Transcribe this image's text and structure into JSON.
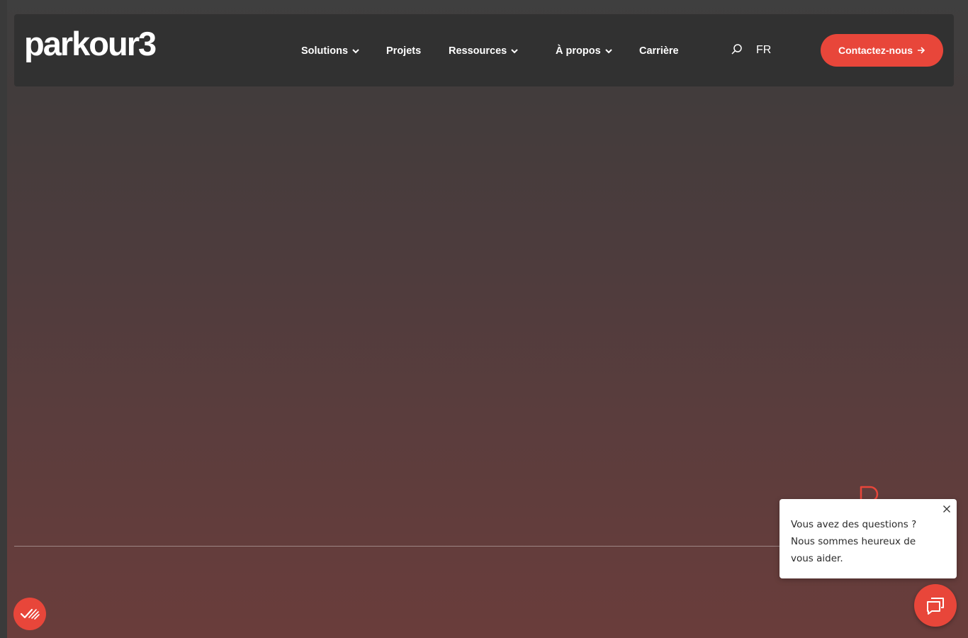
{
  "header": {
    "logo": "parkour3",
    "nav": [
      {
        "label": "Solutions",
        "has_dropdown": true
      },
      {
        "label": "Projets",
        "has_dropdown": false
      },
      {
        "label": "Ressources",
        "has_dropdown": true
      },
      {
        "label": "À propos",
        "has_dropdown": true
      },
      {
        "label": "Carrière",
        "has_dropdown": false
      }
    ],
    "search_icon": "search-icon",
    "language": "FR",
    "cta_label": "Contactez-nous",
    "cta_icon": "arrow-right-icon"
  },
  "chat": {
    "message": "Vous avez des questions ? Nous sommes heureux de vous aider.",
    "close_icon": "close-icon",
    "open_icon": "chat-bubbles-icon"
  },
  "consent": {
    "icon": "cookie-consent-icon"
  },
  "colors": {
    "accent": "#e8463a",
    "header_bg": "#313131",
    "text_light": "#ffffff"
  }
}
